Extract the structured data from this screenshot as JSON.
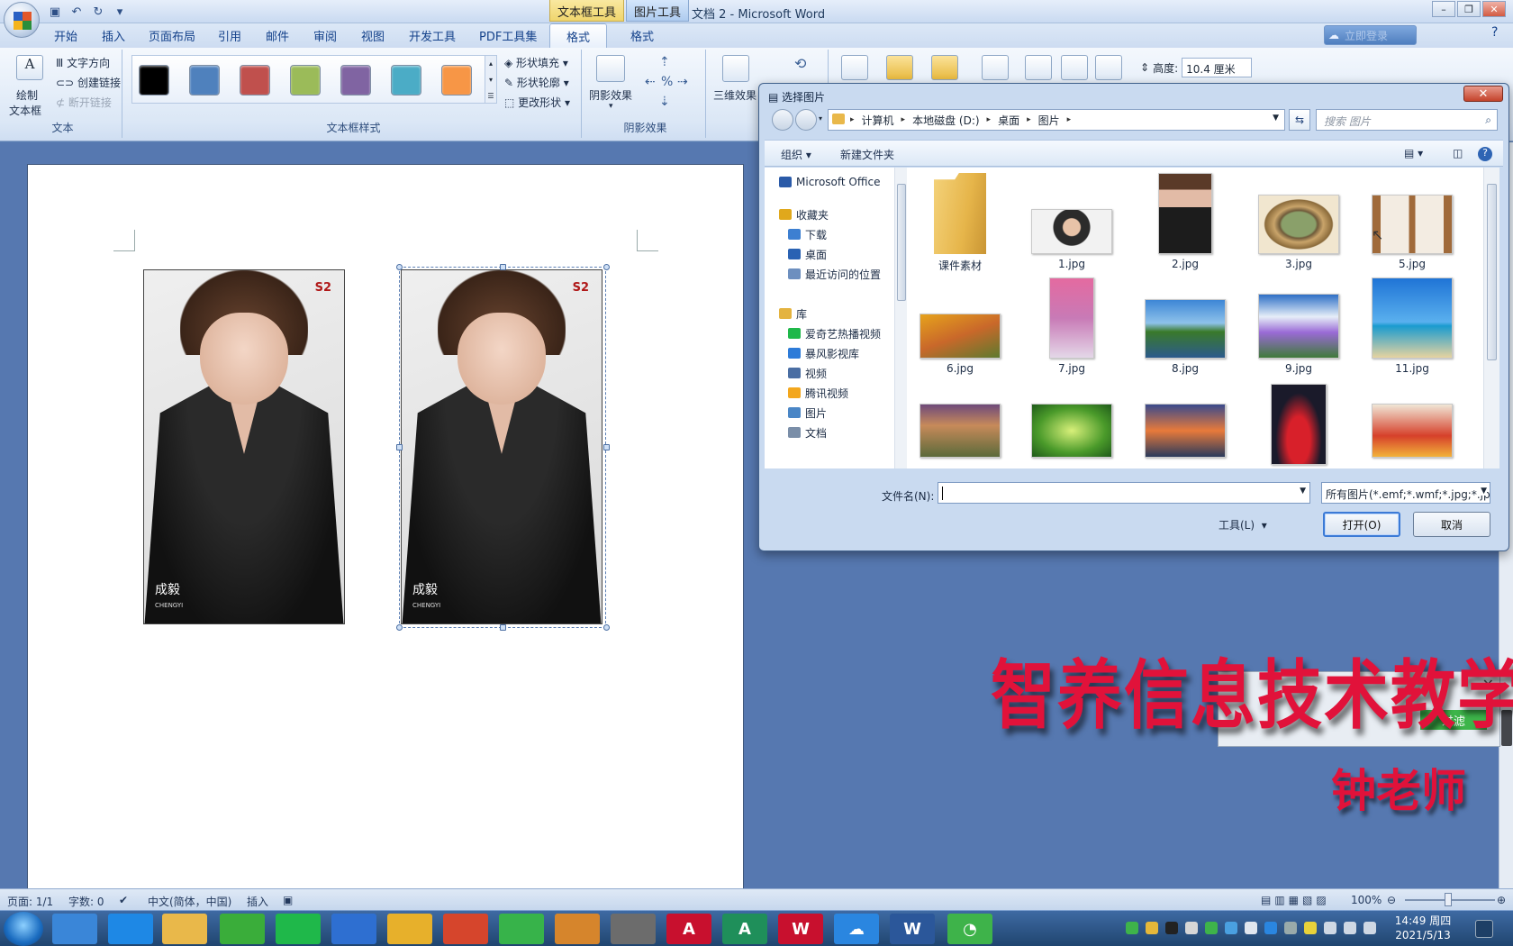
{
  "window": {
    "title": "文档 2 - Microsoft Word",
    "context_tabs": [
      "文本框工具",
      "图片工具"
    ]
  },
  "ribbon": {
    "tabs": [
      "开始",
      "插入",
      "页面布局",
      "引用",
      "邮件",
      "审阅",
      "视图",
      "开发工具",
      "PDF工具集",
      "格式",
      "格式"
    ],
    "active_tab_index": 9,
    "sign_in_label": "立即登录",
    "text_group": {
      "label": "文本",
      "draw_textbox": "绘制",
      "draw_textbox2": "文本框",
      "text_direction": "文字方向",
      "create_link": "创建链接",
      "break_link": "断开链接"
    },
    "style_group": {
      "label": "文本框样式",
      "swatches": [
        "#000000",
        "#4f81bd",
        "#c0504d",
        "#9bbb59",
        "#8064a2",
        "#4bacc6",
        "#f79646"
      ],
      "shape_fill": "形状填充",
      "shape_outline": "形状轮廓",
      "change_shape": "更改形状"
    },
    "shadow_group": {
      "label": "阴影效果",
      "button": "阴影效果"
    },
    "threed_group": {
      "label": "三",
      "button": "三维效果"
    },
    "height_label": "高度:",
    "height_value": "10.4 厘米"
  },
  "document": {
    "photo_name": "成毅",
    "photo_sub": "CHENGYI",
    "photo_logo": "S2"
  },
  "dialog": {
    "title": "选择图片",
    "breadcrumb": [
      "计算机",
      "本地磁盘 (D:)",
      "桌面",
      "图片"
    ],
    "search_placeholder": "搜索 图片",
    "organize": "组织",
    "new_folder": "新建文件夹",
    "nav_items": [
      {
        "label": "Microsoft Office",
        "icon": "office-icon",
        "color": "#2a5aa8"
      },
      {
        "label": "收藏夹",
        "icon": "star-icon",
        "color": "#e0a81c"
      },
      {
        "label": "下载",
        "icon": "download-folder-icon",
        "color": "#3d7fd1"
      },
      {
        "label": "桌面",
        "icon": "desktop-icon",
        "color": "#2a62b3"
      },
      {
        "label": "最近访问的位置",
        "icon": "recent-places-icon",
        "color": "#6d8fbf"
      },
      {
        "label": "库",
        "icon": "library-icon",
        "color": "#e4b33f"
      },
      {
        "label": "爱奇艺热播视频",
        "icon": "iqiyi-icon",
        "color": "#1fb84a"
      },
      {
        "label": "暴风影视库",
        "icon": "storm-icon",
        "color": "#2d7bd8"
      },
      {
        "label": "视频",
        "icon": "video-library-icon",
        "color": "#4a6ea3"
      },
      {
        "label": "腾讯视频",
        "icon": "tencent-video-icon",
        "color": "#f3a71d"
      },
      {
        "label": "图片",
        "icon": "pictures-library-icon",
        "color": "#4a86c6"
      },
      {
        "label": "文档",
        "icon": "documents-library-icon",
        "color": "#7a8ea8"
      }
    ],
    "files": [
      {
        "name": "课件素材",
        "type": "folder"
      },
      {
        "name": "1.jpg",
        "type": "portrait-wide"
      },
      {
        "name": "2.jpg",
        "type": "portrait"
      },
      {
        "name": "3.jpg",
        "type": "frame"
      },
      {
        "name": "5.jpg",
        "type": "frame2"
      },
      {
        "name": "6.jpg",
        "type": "autumn"
      },
      {
        "name": "7.jpg",
        "type": "pink"
      },
      {
        "name": "8.jpg",
        "type": "lake"
      },
      {
        "name": "9.jpg",
        "type": "flowers"
      },
      {
        "name": "11.jpg",
        "type": "sea"
      },
      {
        "name": "",
        "type": "sunset"
      },
      {
        "name": "",
        "type": "forest"
      },
      {
        "name": "",
        "type": "dusk"
      },
      {
        "name": "",
        "type": "red-dress"
      },
      {
        "name": "",
        "type": "dancers"
      }
    ],
    "filename_label": "文件名(N):",
    "filename_value": "",
    "filter_value": "所有图片(*.emf;*.wmf;*.jpg;*.jp",
    "tools": "工具(L)",
    "open": "打开(O)",
    "cancel": "取消"
  },
  "watermark": {
    "title": "智养信息技术教学",
    "teacher": "钟老师",
    "popup_button": "过滤"
  },
  "statusbar": {
    "page": "页面: 1/1",
    "words": "字数: 0",
    "language": "中文(简体，中国)",
    "mode": "插入",
    "zoom": "100%"
  },
  "taskbar": {
    "time": "14:49 周四",
    "date": "2021/5/13",
    "apps": [
      {
        "icon": "snail-icon",
        "color": "#3a86d8"
      },
      {
        "icon": "ie-icon",
        "color": "#1e88e5"
      },
      {
        "icon": "explorer-icon",
        "color": "#e9b84a"
      },
      {
        "icon": "browser360-icon",
        "color": "#3aad3a"
      },
      {
        "icon": "iqiyi-icon",
        "color": "#1fb84a"
      },
      {
        "icon": "video-icon",
        "color": "#2e6fd1"
      },
      {
        "icon": "chrome-icon",
        "color": "#e7b02b"
      },
      {
        "icon": "paint-icon",
        "color": "#d6452c"
      },
      {
        "icon": "player-icon",
        "color": "#37b34a"
      },
      {
        "icon": "photo-viewer-icon",
        "color": "#d6852c"
      },
      {
        "icon": "folder-tool-icon",
        "color": "#6c6c6c"
      },
      {
        "icon": "acrobat-icon",
        "color": "#c8102e"
      },
      {
        "icon": "publisher-icon",
        "color": "#1f8f5a"
      },
      {
        "icon": "wps-icon",
        "color": "#c8102e"
      },
      {
        "icon": "baidu-cloud-icon",
        "color": "#2a86e0"
      },
      {
        "icon": "word-icon",
        "color": "#2b579a"
      },
      {
        "icon": "wechat-icon",
        "color": "#3eb34a"
      }
    ]
  }
}
